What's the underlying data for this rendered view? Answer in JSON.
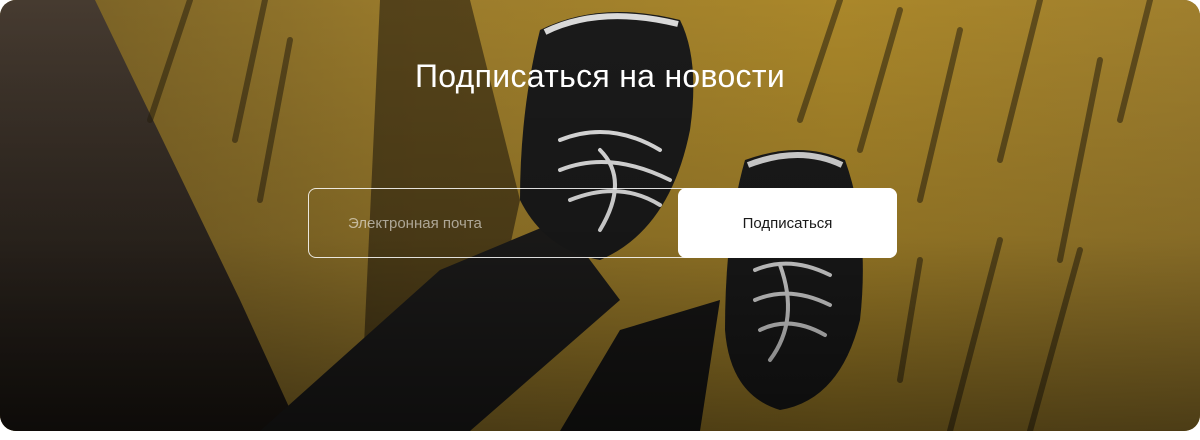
{
  "newsletter": {
    "title": "Подписаться на новости",
    "email_placeholder": "Электронная почта",
    "email_value": "",
    "submit_label": "Подписаться"
  },
  "background": {
    "subject": "sneakers-on-yellow-wall-photo",
    "wall_color": "#b8912c",
    "shoe_color": "#1c1c1c"
  }
}
